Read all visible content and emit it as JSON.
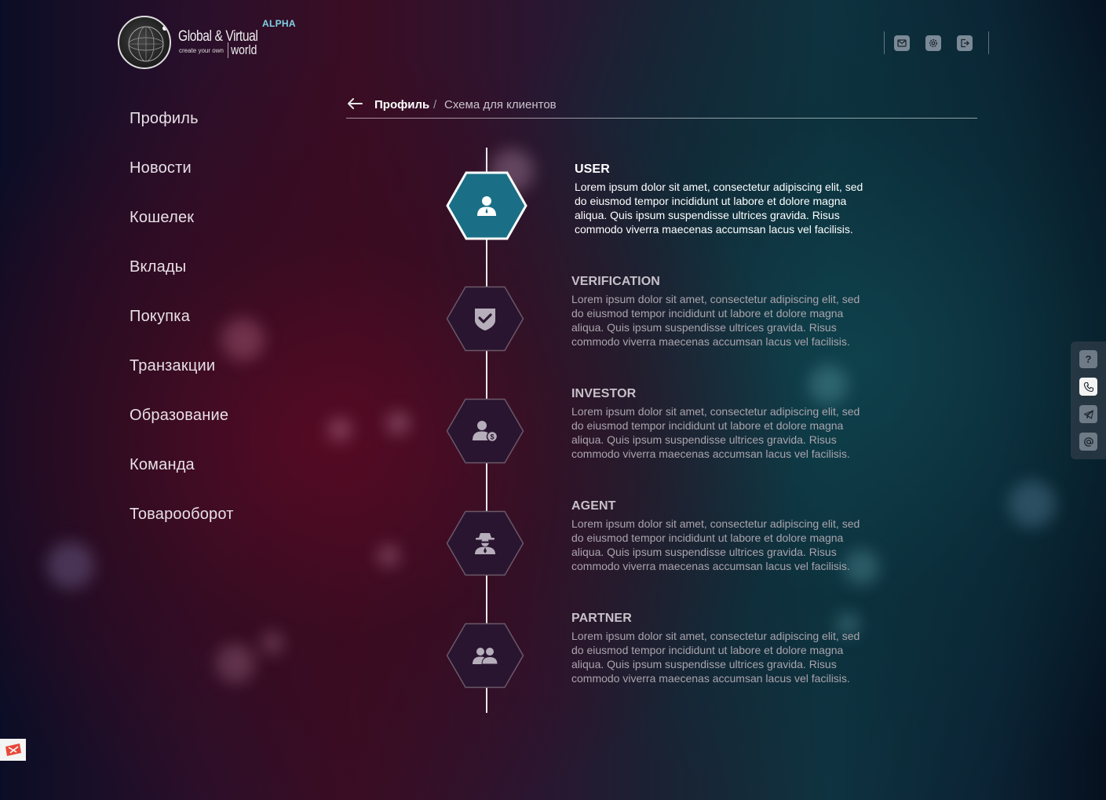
{
  "header": {
    "logo_title": "Global & Virtual",
    "logo_sub": "create your own",
    "logo_world": "world",
    "badge": "ALPHA",
    "icons": [
      "mail-icon",
      "settings-icon",
      "logout-icon"
    ]
  },
  "sidebar": {
    "items": [
      {
        "label": "Профиль"
      },
      {
        "label": "Новости"
      },
      {
        "label": "Кошелек"
      },
      {
        "label": "Вклады"
      },
      {
        "label": "Покупка"
      },
      {
        "label": "Транзакции"
      },
      {
        "label": "Образование"
      },
      {
        "label": "Команда"
      },
      {
        "label": "Товарооборот"
      }
    ]
  },
  "breadcrumb": {
    "current": "Профиль",
    "separator": "/",
    "page": "Схема для клиентов"
  },
  "steps": [
    {
      "title": "USER",
      "icon": "user-icon",
      "active": true,
      "desc": "Lorem ipsum dolor sit amet, consectetur adipiscing elit, sed do eiusmod tempor incididunt ut labore et dolore magna aliqua. Quis ipsum suspendisse ultrices gravida. Risus commodo viverra maecenas accumsan lacus vel facilisis."
    },
    {
      "title": "VERIFICATION",
      "icon": "shield-check-icon",
      "active": false,
      "desc": "Lorem ipsum dolor sit amet, consectetur adipiscing elit, sed do eiusmod tempor incididunt ut labore et dolore magna aliqua. Quis ipsum suspendisse ultrices gravida. Risus commodo viverra maecenas accumsan lacus vel facilisis."
    },
    {
      "title": "INVESTOR",
      "icon": "investor-icon",
      "active": false,
      "desc": "Lorem ipsum dolor sit amet, consectetur adipiscing elit, sed do eiusmod tempor incididunt ut labore et dolore magna aliqua. Quis ipsum suspendisse ultrices gravida. Risus commodo viverra maecenas accumsan lacus vel facilisis."
    },
    {
      "title": "AGENT",
      "icon": "agent-icon",
      "active": false,
      "desc": "Lorem ipsum dolor sit amet, consectetur adipiscing elit, sed do eiusmod tempor incididunt ut labore et dolore magna aliqua. Quis ipsum suspendisse ultrices gravida. Risus commodo viverra maecenas accumsan lacus vel facilisis."
    },
    {
      "title": "PARTNER",
      "icon": "partners-icon",
      "active": false,
      "desc": "Lorem ipsum dolor sit amet, consectetur adipiscing elit, sed do eiusmod tempor incididunt ut labore et dolore magna aliqua. Quis ipsum suspendisse ultrices gravida. Risus commodo viverra maecenas accumsan lacus vel facilisis."
    }
  ],
  "contact": {
    "help_label": "?",
    "icons": [
      "help-icon",
      "phone-icon",
      "telegram-icon",
      "email-at-icon"
    ]
  },
  "colors": {
    "accent": "#1a6f86",
    "alpha_badge": "#7fd3e6",
    "hex_inactive": "#2a1530"
  }
}
